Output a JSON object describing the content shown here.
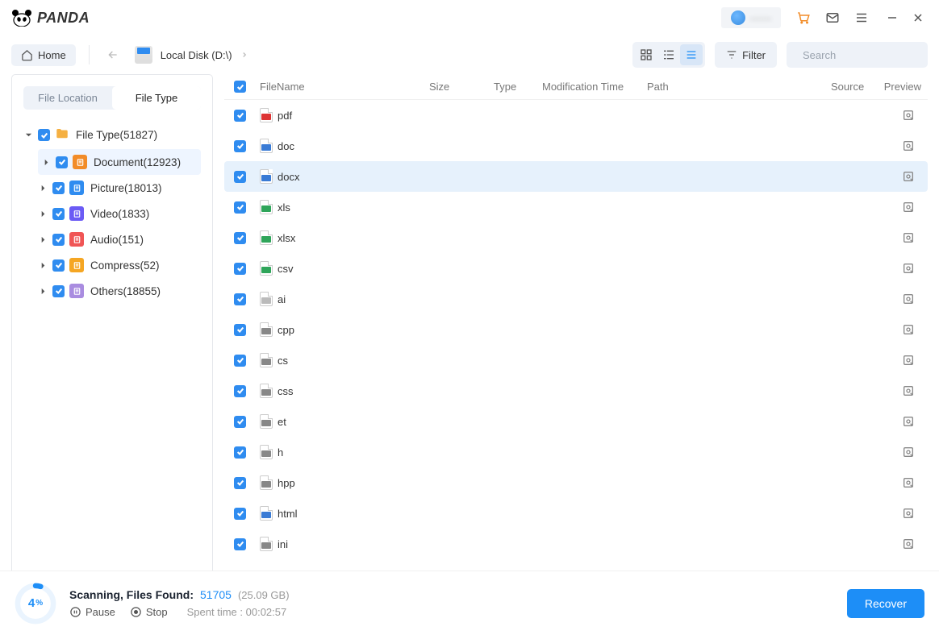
{
  "brand": "PANDA",
  "user": {
    "name_blurred": "------"
  },
  "toolbar": {
    "home": "Home",
    "disk_label": "Local Disk (D:\\)",
    "filter": "Filter",
    "search_placeholder": "Search"
  },
  "sidebar": {
    "tab_location": "File Location",
    "tab_type": "File Type",
    "root": {
      "label": "File Type",
      "count": 51827
    },
    "items": [
      {
        "label": "Document",
        "count": 12923,
        "icon_bg": "#f28c28",
        "active": true
      },
      {
        "label": "Picture",
        "count": 18013,
        "icon_bg": "#2f8cf0"
      },
      {
        "label": "Video",
        "count": 1833,
        "icon_bg": "#6b5bf5"
      },
      {
        "label": "Audio",
        "count": 151,
        "icon_bg": "#f05555"
      },
      {
        "label": "Compress",
        "count": 52,
        "icon_bg": "#f5a623"
      },
      {
        "label": "Others",
        "count": 18855,
        "icon_bg": "#a98ce0"
      }
    ]
  },
  "columns": {
    "name": "FileName",
    "size": "Size",
    "type": "Type",
    "mod": "Modification Time",
    "path": "Path",
    "src": "Source",
    "prev": "Preview"
  },
  "rows": [
    {
      "name": "pdf",
      "color": "#d33",
      "highlight": false
    },
    {
      "name": "doc",
      "color": "#3a7bd5",
      "highlight": false
    },
    {
      "name": "docx",
      "color": "#3a7bd5",
      "highlight": true
    },
    {
      "name": "xls",
      "color": "#2fa55a",
      "highlight": false
    },
    {
      "name": "xlsx",
      "color": "#2fa55a",
      "highlight": false
    },
    {
      "name": "csv",
      "color": "#2fa55a",
      "highlight": false
    },
    {
      "name": "ai",
      "color": "#bbb",
      "highlight": false
    },
    {
      "name": "cpp",
      "color": "#888",
      "highlight": false
    },
    {
      "name": "cs",
      "color": "#888",
      "highlight": false
    },
    {
      "name": "css",
      "color": "#888",
      "highlight": false
    },
    {
      "name": "et",
      "color": "#888",
      "highlight": false
    },
    {
      "name": "h",
      "color": "#888",
      "highlight": false
    },
    {
      "name": "hpp",
      "color": "#888",
      "highlight": false
    },
    {
      "name": "html",
      "color": "#3a7bd5",
      "highlight": false
    },
    {
      "name": "ini",
      "color": "#888",
      "highlight": false
    }
  ],
  "footer": {
    "percent": "4",
    "title": "Scanning, Files Found:",
    "count": "51705",
    "size_text": "(25.09 GB)",
    "pause": "Pause",
    "stop": "Stop",
    "spent_label": "Spent time :",
    "spent_value": "00:02:57",
    "recover": "Recover"
  }
}
